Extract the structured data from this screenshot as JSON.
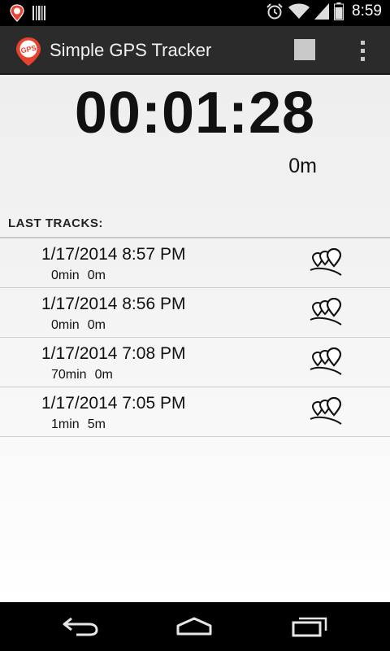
{
  "status_bar": {
    "time": "8:59",
    "icons": [
      "gps-notification-icon",
      "barcode-icon",
      "alarm-icon",
      "wifi-icon",
      "signal-icon",
      "battery-icon"
    ]
  },
  "action_bar": {
    "title": "Simple GPS Tracker",
    "app_icon_text": "GPS",
    "actions": [
      "stop-icon",
      "overflow-menu-icon"
    ]
  },
  "tracker": {
    "elapsed": "00:01:28",
    "distance": "0m"
  },
  "tracks": {
    "header": "LAST TRACKS:",
    "items": [
      {
        "date": "1/17/2014 8:57 PM",
        "duration": "0min",
        "distance": "0m"
      },
      {
        "date": "1/17/2014 8:56 PM",
        "duration": "0min",
        "distance": "0m"
      },
      {
        "date": "1/17/2014 7:08 PM",
        "duration": "70min",
        "distance": "0m"
      },
      {
        "date": "1/17/2014 7:05 PM",
        "duration": "1min",
        "distance": "5m"
      }
    ]
  },
  "nav_bar": {
    "buttons": [
      "back-icon",
      "home-icon",
      "recent-apps-icon"
    ]
  },
  "colors": {
    "status_bar": "#000000",
    "action_bar": "#2b2b2b",
    "app_icon_red": "#e8432f",
    "stop_icon": "#c8c8c8",
    "text": "#111111"
  }
}
